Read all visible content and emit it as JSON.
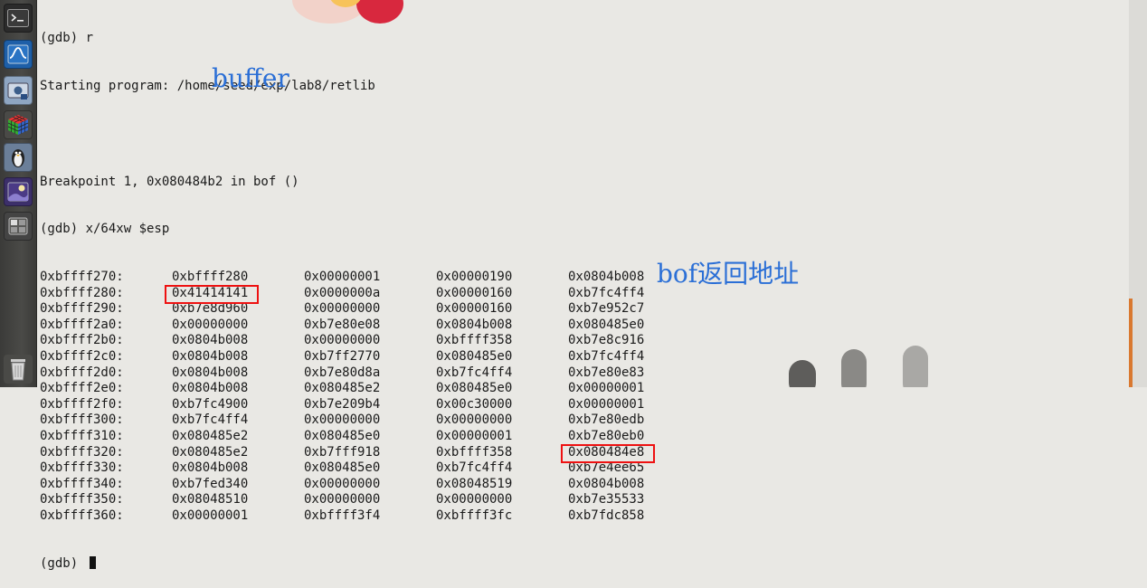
{
  "launcher": {
    "items": [
      {
        "name": "terminal-icon"
      },
      {
        "name": "system-monitor-icon"
      },
      {
        "name": "screenshot-icon"
      },
      {
        "name": "rubiks-cube-icon"
      },
      {
        "name": "linux-penguin-icon"
      },
      {
        "name": "wallpaper-icon"
      },
      {
        "name": "workspace-switcher-icon"
      }
    ],
    "trash": {
      "name": "trash-icon"
    }
  },
  "terminal": {
    "lines": {
      "cmd_run": "(gdb) r",
      "starting": "Starting program: /home/seed/exp/lab8/retlib",
      "blank": "",
      "breakpoint": "Breakpoint 1, 0x080484b2 in bof ()",
      "cmd_examine": "(gdb) x/64xw $esp",
      "prompt": "(gdb) "
    },
    "dump": [
      {
        "addr": "0xbffff270:",
        "w": [
          "0xbffff280",
          "0x00000001",
          "0x00000190",
          "0x0804b008"
        ]
      },
      {
        "addr": "0xbffff280:",
        "w": [
          "0x41414141",
          "0x0000000a",
          "0x00000160",
          "0xb7fc4ff4"
        ]
      },
      {
        "addr": "0xbffff290:",
        "w": [
          "0xb7e8d960",
          "0x00000000",
          "0x00000160",
          "0xb7e952c7"
        ]
      },
      {
        "addr": "0xbffff2a0:",
        "w": [
          "0x00000000",
          "0xb7e80e08",
          "0x0804b008",
          "0x080485e0"
        ]
      },
      {
        "addr": "0xbffff2b0:",
        "w": [
          "0x0804b008",
          "0x00000000",
          "0xbffff358",
          "0xb7e8c916"
        ]
      },
      {
        "addr": "0xbffff2c0:",
        "w": [
          "0x0804b008",
          "0xb7ff2770",
          "0x080485e0",
          "0xb7fc4ff4"
        ]
      },
      {
        "addr": "0xbffff2d0:",
        "w": [
          "0x0804b008",
          "0xb7e80d8a",
          "0xb7fc4ff4",
          "0xb7e80e83"
        ]
      },
      {
        "addr": "0xbffff2e0:",
        "w": [
          "0x0804b008",
          "0x080485e2",
          "0x080485e0",
          "0x00000001"
        ]
      },
      {
        "addr": "0xbffff2f0:",
        "w": [
          "0xb7fc4900",
          "0xb7e209b4",
          "0x00c30000",
          "0x00000001"
        ]
      },
      {
        "addr": "0xbffff300:",
        "w": [
          "0xb7fc4ff4",
          "0x00000000",
          "0x00000000",
          "0xb7e80edb"
        ]
      },
      {
        "addr": "0xbffff310:",
        "w": [
          "0x080485e2",
          "0x080485e0",
          "0x00000001",
          "0xb7e80eb0"
        ]
      },
      {
        "addr": "0xbffff320:",
        "w": [
          "0x080485e2",
          "0xb7fff918",
          "0xbffff358",
          "0x080484e8"
        ]
      },
      {
        "addr": "0xbffff330:",
        "w": [
          "0x0804b008",
          "0x080485e0",
          "0xb7fc4ff4",
          "0xb7e4ee65"
        ]
      },
      {
        "addr": "0xbffff340:",
        "w": [
          "0xb7fed340",
          "0x00000000",
          "0x08048519",
          "0x0804b008"
        ]
      },
      {
        "addr": "0xbffff350:",
        "w": [
          "0x08048510",
          "0x00000000",
          "0x00000000",
          "0xb7e35533"
        ]
      },
      {
        "addr": "0xbffff360:",
        "w": [
          "0x00000001",
          "0xbffff3f4",
          "0xbffff3fc",
          "0xb7fdc858"
        ]
      }
    ]
  },
  "annotations": {
    "buffer_label": "buffer",
    "return_label": "bof返回地址",
    "label_color": "#2b6fd6",
    "box_color": "#ee1111"
  }
}
